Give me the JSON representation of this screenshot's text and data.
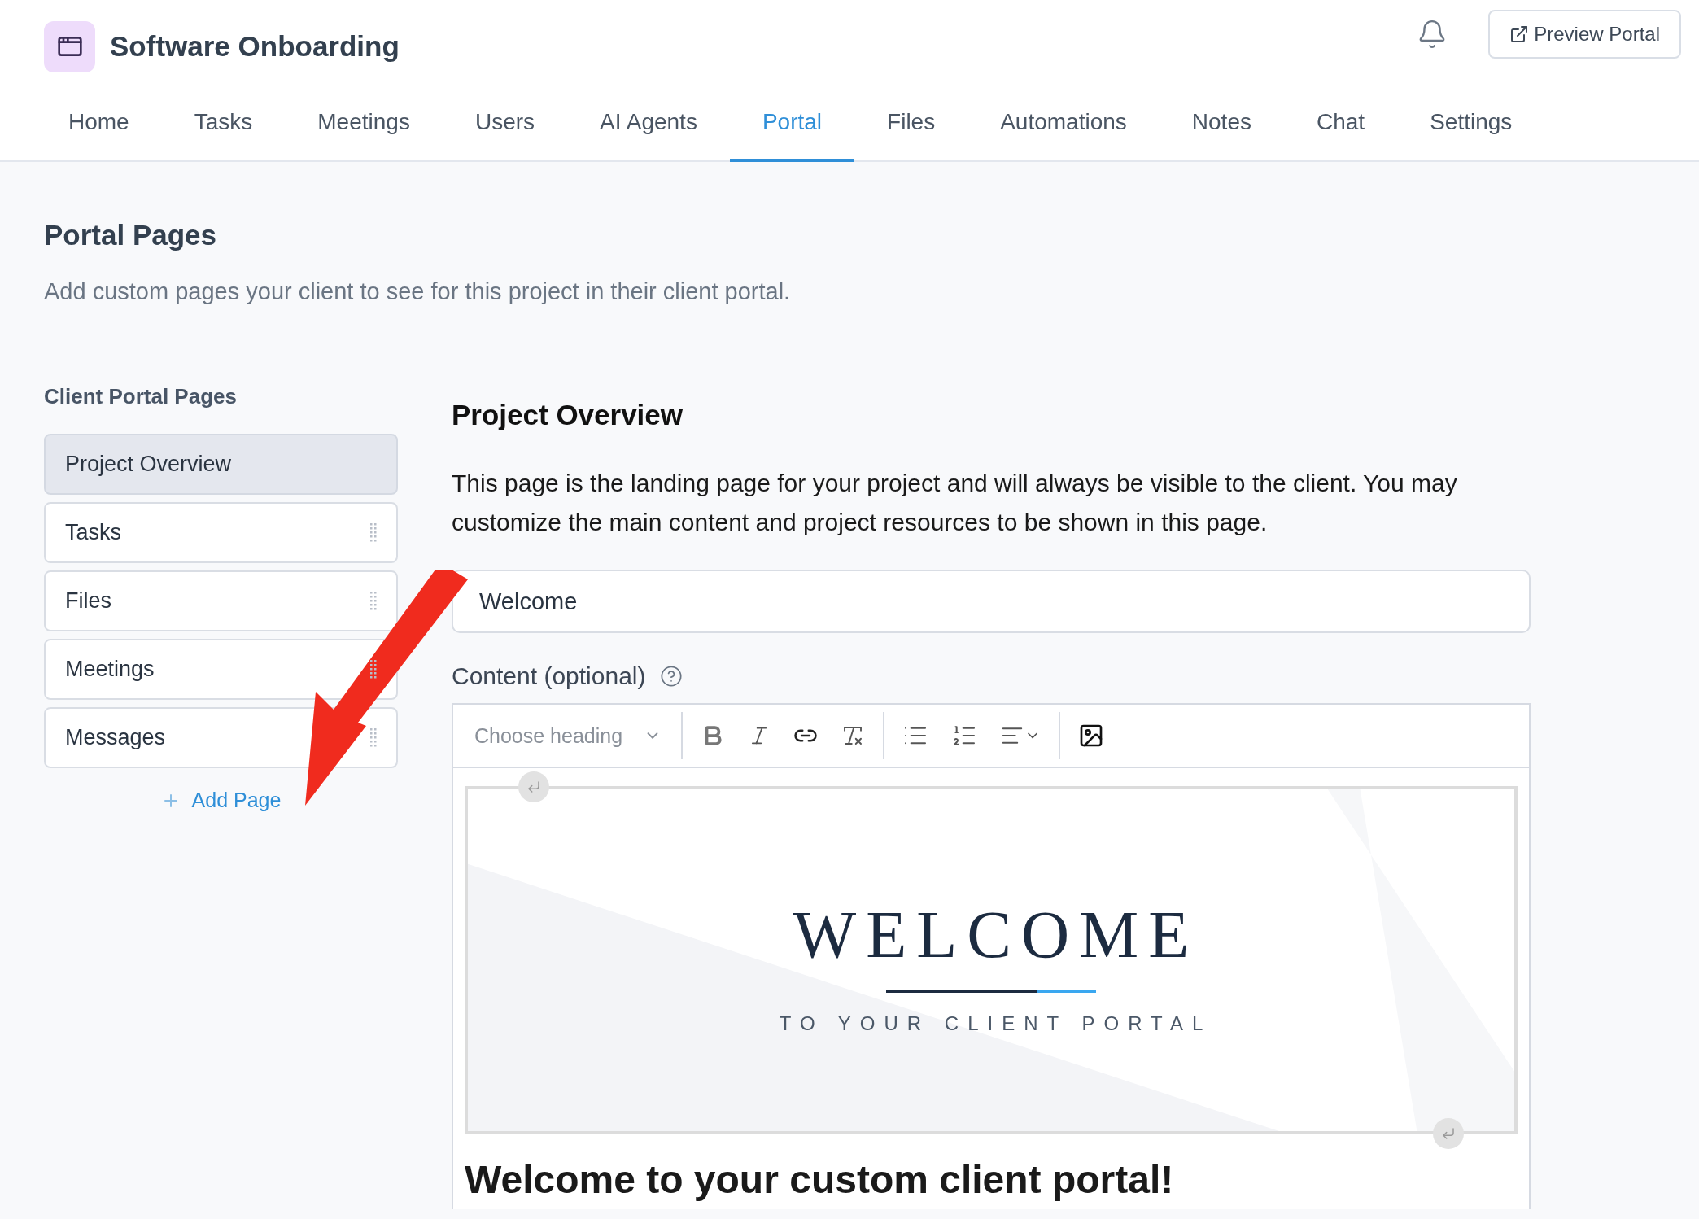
{
  "project": {
    "title": "Software Onboarding"
  },
  "header_actions": {
    "preview_button": "Preview Portal"
  },
  "tabs": [
    {
      "label": "Home",
      "selected": false
    },
    {
      "label": "Tasks",
      "selected": false
    },
    {
      "label": "Meetings",
      "selected": false
    },
    {
      "label": "Users",
      "selected": false
    },
    {
      "label": "AI Agents",
      "selected": false
    },
    {
      "label": "Portal",
      "selected": true
    },
    {
      "label": "Files",
      "selected": false
    },
    {
      "label": "Automations",
      "selected": false
    },
    {
      "label": "Notes",
      "selected": false
    },
    {
      "label": "Chat",
      "selected": false
    },
    {
      "label": "Settings",
      "selected": false
    }
  ],
  "section": {
    "title": "Portal Pages",
    "subtitle": "Add custom pages your client to see for this project in their client portal."
  },
  "sidebar": {
    "title": "Client Portal Pages",
    "items": [
      {
        "label": "Project Overview",
        "selected": true
      },
      {
        "label": "Tasks",
        "selected": false
      },
      {
        "label": "Files",
        "selected": false
      },
      {
        "label": "Meetings",
        "selected": false
      },
      {
        "label": "Messages",
        "selected": false
      }
    ],
    "add_button": "Add Page"
  },
  "editor": {
    "title": "Project Overview",
    "description": "This page is the landing page for your project and will always be visible to the client. You may customize the main content and project resources to be shown in this page.",
    "name_value": "Welcome",
    "content_label": "Content (optional)",
    "heading_select": "Choose heading",
    "banner": {
      "title": "WELCOME",
      "subtitle": "TO YOUR CLIENT PORTAL"
    },
    "body_heading": "Welcome to your custom client portal!"
  }
}
